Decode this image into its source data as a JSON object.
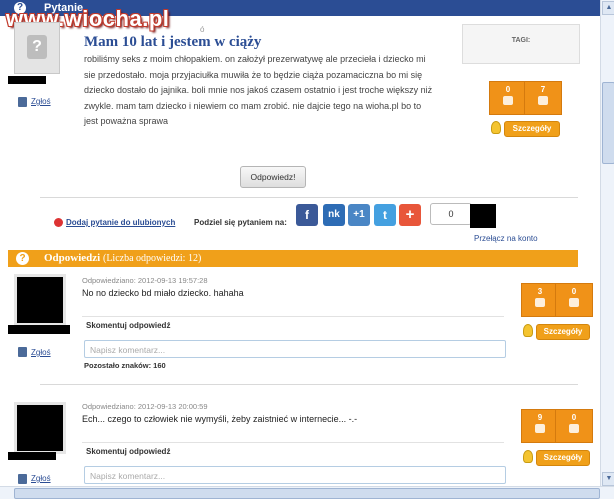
{
  "watermark": "www.wiocha.pl",
  "question_header": {
    "title": "Pytanie"
  },
  "question": {
    "small_text": "ó",
    "title": "Mam 10 lat i jestem w ciąży",
    "body": "robiliśmy seks z moim chłopakiem. on założył prezerwatywę ale przecieła i dziecko mi sie przedostało. moja przyjaciułka muwiła że to będzie ciąża pozamaciczna bo mi się dziecko dostało do jajnika. boli mnie nos jakoś czasem ostatnio i jest troche większy niż zwykle. mam tam dziecko i niewiem co mam zrobić. nie dajcie tego na wioha.pl bo to jest poważna sprawa",
    "report_label": "Zgłoś",
    "tags_label": "TAGI:",
    "votes_up": "0",
    "votes_down": "7",
    "details_label": "Szczegóły",
    "answer_button": "Odpowiedz!"
  },
  "share": {
    "favorite_link": "Dodaj pytanie do ulubionych",
    "share_label": "Podziel się pytaniem na:",
    "buttons": [
      {
        "icon": "facebook-icon",
        "glyph": "f",
        "color": "#3b5998"
      },
      {
        "icon": "nk-icon",
        "glyph": "nk",
        "color": "#2d6cb5"
      },
      {
        "icon": "google-plus-one-icon",
        "glyph": "+1",
        "color": "#4a86c5"
      },
      {
        "icon": "twitter-icon",
        "glyph": "t",
        "color": "#44a0e0"
      },
      {
        "icon": "add-share-icon",
        "glyph": "+",
        "color": "#e8563a"
      }
    ],
    "count": "0",
    "switch_account": "Przełącz na konto"
  },
  "answers_header": {
    "title": "Odpowiedzi",
    "count_text": "(Liczba odpowiedzi: 12)"
  },
  "answers": [
    {
      "answered": "Odpowiedziano: 2012-09-13 19:57:28",
      "text": "No no dziecko bd miało dziecko. hahaha",
      "votes_up": "3",
      "votes_down": "0",
      "details_label": "Szczegóły",
      "report_label": "Zgłoś",
      "comment_title": "Skomentuj odpowiedź",
      "comment_placeholder": "Napisz komentarz...",
      "remaining_label": "Pozostało znaków: 160"
    },
    {
      "answered": "Odpowiedziano: 2012-09-13 20:00:59",
      "text": "Ech... czego to człowiek nie wymyśli, żeby zaistnieć w internecie... -.-",
      "votes_up": "9",
      "votes_down": "0",
      "details_label": "Szczegóły",
      "report_label": "Zgłoś",
      "comment_title": "Skomentuj odpowiedź",
      "comment_placeholder": "Napisz komentarz..."
    }
  ]
}
